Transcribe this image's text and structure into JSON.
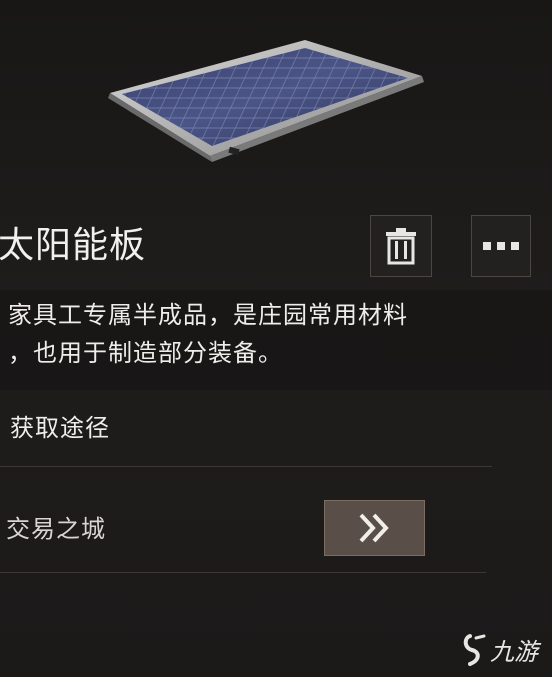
{
  "item": {
    "name": "太阳能板",
    "description_line1": "家具工专属半成品，是庄园常用材料",
    "description_line2": "，也用于制造部分装备。",
    "image_icon": "solar-panel-icon"
  },
  "actions": {
    "delete_icon": "trash-icon",
    "more_icon": "more-dots-icon"
  },
  "acquire": {
    "section_title": "获取途径",
    "sources": [
      {
        "label": "交易之城",
        "go_icon": "double-chevron-right-icon"
      }
    ]
  },
  "watermark": {
    "text": "九游",
    "icon": "jiuyou-logo-icon"
  },
  "colors": {
    "background": "#1d1b1a",
    "go_button": "#5a4f48",
    "text": "#efedea"
  }
}
